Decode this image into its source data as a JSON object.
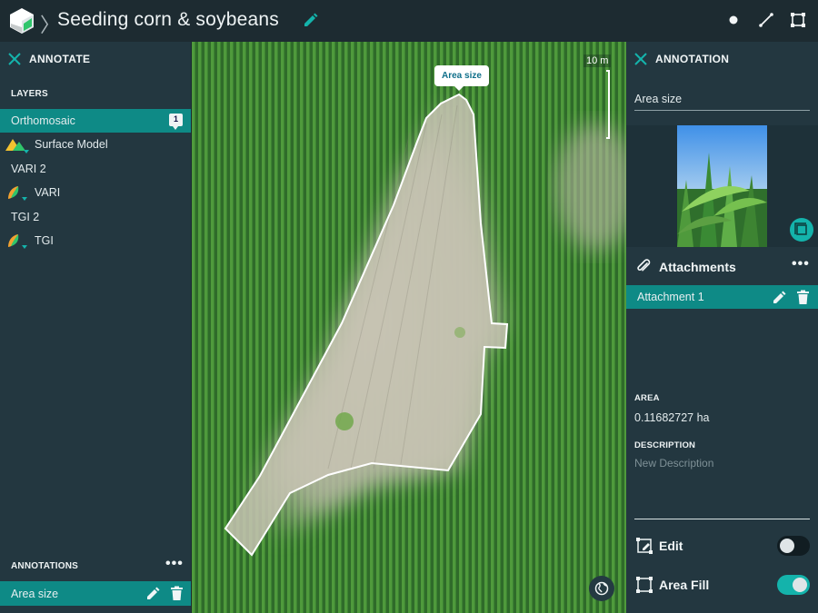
{
  "app": {
    "title": "Seeding corn & soybeans",
    "breadcrumb_separator": "〉"
  },
  "left_panel": {
    "header": "ANNOTATE",
    "layers_label": "LAYERS",
    "layers": [
      {
        "label": "Orthomosaic",
        "badge": "1",
        "active": true,
        "icon": "none"
      },
      {
        "label": "Surface Model",
        "icon": "surface-model-icon"
      },
      {
        "label": "VARI 2",
        "icon": "none"
      },
      {
        "label": "VARI",
        "icon": "plant-health-icon"
      },
      {
        "label": "TGI 2",
        "icon": "none"
      },
      {
        "label": "TGI",
        "icon": "plant-health-icon"
      }
    ],
    "annotations_label": "ANNOTATIONS",
    "annotations": [
      {
        "label": "Area size"
      }
    ]
  },
  "map": {
    "tooltip": "Area size",
    "scale_label": "10 m"
  },
  "right_panel": {
    "header": "ANNOTATION",
    "name_value": "Area size",
    "attachments_label": "Attachments",
    "attachments": [
      {
        "label": "Attachment 1"
      }
    ],
    "area_label": "AREA",
    "area_value": "0.11682727 ha",
    "description_label": "DESCRIPTION",
    "description_placeholder": "New Description",
    "toggles": {
      "edit_label": "Edit",
      "edit_on": false,
      "fill_label": "Area Fill",
      "fill_on": true
    }
  },
  "colors": {
    "accent": "#0e8a86",
    "toggle_on": "#14b3ab",
    "panel": "#233740",
    "topbar": "#1d2b31"
  }
}
